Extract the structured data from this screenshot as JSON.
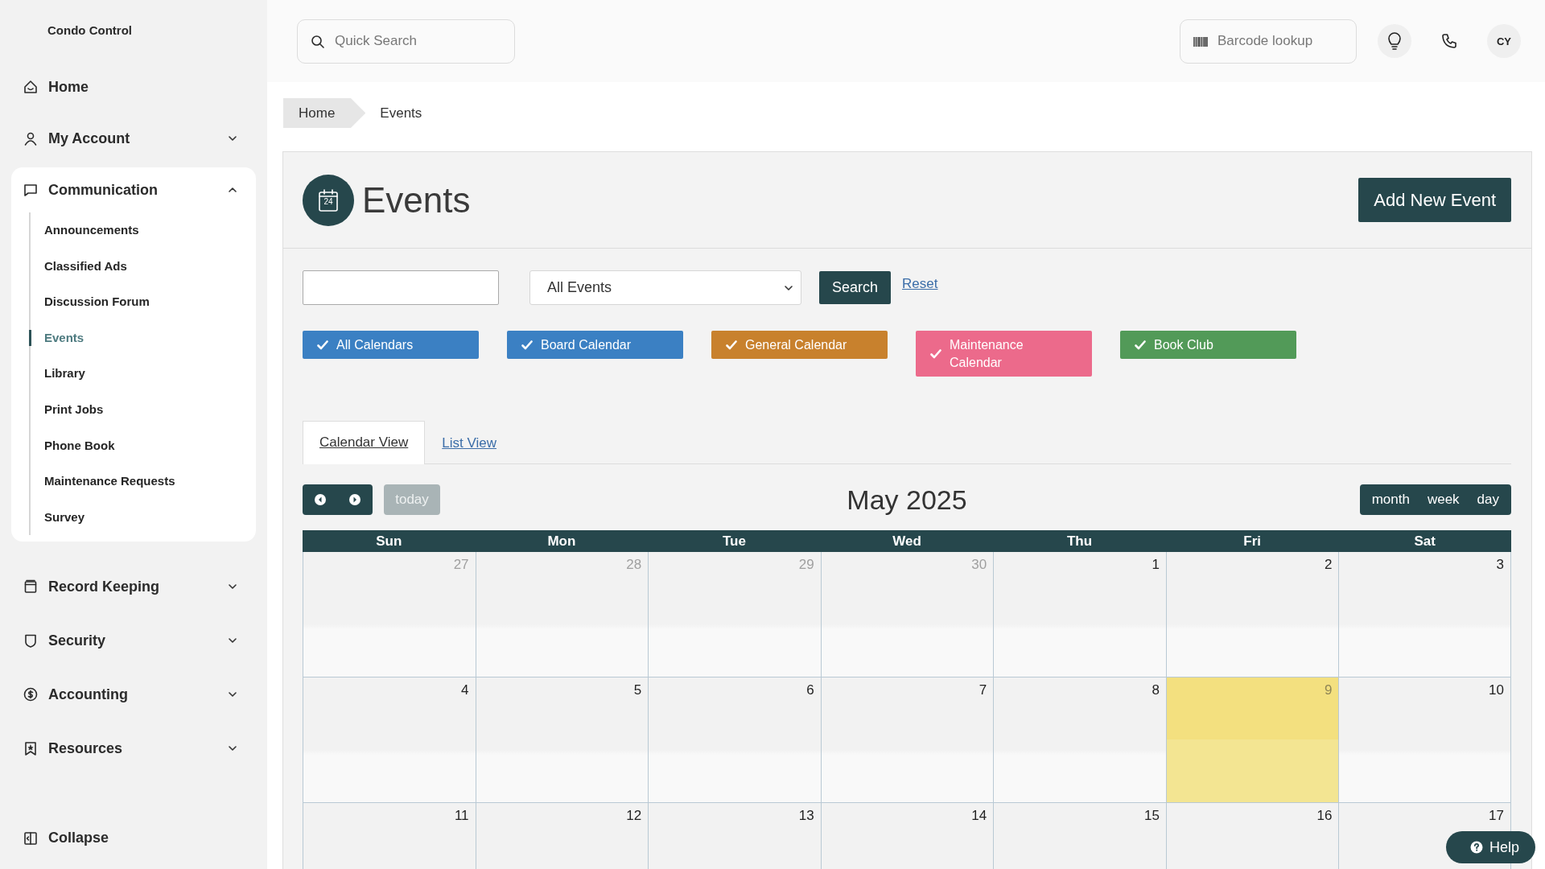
{
  "sidebar": {
    "brand": "Condo Control",
    "items": [
      {
        "kind": "link",
        "label": "Home"
      },
      {
        "kind": "group",
        "label": "My Account",
        "expanded": false
      },
      {
        "kind": "group",
        "label": "Communication",
        "expanded": true,
        "children": [
          {
            "label": "Announcements",
            "selected": false
          },
          {
            "label": "Classified Ads",
            "selected": false
          },
          {
            "label": "Discussion Forum",
            "selected": false
          },
          {
            "label": "Events",
            "selected": true
          },
          {
            "label": "Library",
            "selected": false
          },
          {
            "label": "Print Jobs",
            "selected": false
          },
          {
            "label": "Phone Book",
            "selected": false
          },
          {
            "label": "Maintenance Requests",
            "selected": false
          },
          {
            "label": "Survey",
            "selected": false
          }
        ]
      },
      {
        "kind": "group",
        "label": "Record Keeping",
        "expanded": false
      },
      {
        "kind": "group",
        "label": "Security",
        "expanded": false
      },
      {
        "kind": "group",
        "label": "Accounting",
        "expanded": false
      },
      {
        "kind": "group",
        "label": "Resources",
        "expanded": false
      }
    ],
    "collapse": "Collapse"
  },
  "topbar": {
    "search": {
      "placeholder": "Quick Search"
    },
    "barcode": {
      "placeholder": "Barcode lookup"
    },
    "avatar": "CY"
  },
  "breadcrumb": [
    "Home",
    "Events"
  ],
  "page": {
    "title": "Events",
    "icon_day": "24",
    "add_button": "Add New Event"
  },
  "filters": {
    "select": "All Events",
    "search_button": "Search",
    "reset": "Reset"
  },
  "calendars": [
    {
      "label": "All Calendars",
      "checked": true,
      "color": "#3b80c3"
    },
    {
      "label": "Board Calendar",
      "checked": true,
      "color": "#3b80c3"
    },
    {
      "label": "General Calendar",
      "checked": true,
      "color": "#c8812d"
    },
    {
      "label": "Maintenance Calendar",
      "checked": true,
      "color": "#ec6a8b"
    },
    {
      "label": "Book Club",
      "checked": true,
      "color": "#529a58"
    }
  ],
  "tabs": [
    {
      "label": "Calendar View",
      "selected": true
    },
    {
      "label": "List View",
      "selected": false
    }
  ],
  "calendar": {
    "today_button": "today",
    "title": "May 2025",
    "views": [
      "month",
      "week",
      "day"
    ],
    "weekdays": [
      "Sun",
      "Mon",
      "Tue",
      "Wed",
      "Thu",
      "Fri",
      "Sat"
    ],
    "weeks": [
      [
        {
          "day": "27",
          "other_month": true,
          "today": false
        },
        {
          "day": "28",
          "other_month": true,
          "today": false
        },
        {
          "day": "29",
          "other_month": true,
          "today": false
        },
        {
          "day": "30",
          "other_month": true,
          "today": false
        },
        {
          "day": "1",
          "other_month": false,
          "today": false
        },
        {
          "day": "2",
          "other_month": false,
          "today": false
        },
        {
          "day": "3",
          "other_month": false,
          "today": false
        }
      ],
      [
        {
          "day": "4",
          "other_month": false,
          "today": false
        },
        {
          "day": "5",
          "other_month": false,
          "today": false
        },
        {
          "day": "6",
          "other_month": false,
          "today": false
        },
        {
          "day": "7",
          "other_month": false,
          "today": false
        },
        {
          "day": "8",
          "other_month": false,
          "today": false
        },
        {
          "day": "9",
          "other_month": false,
          "today": true
        },
        {
          "day": "10",
          "other_month": false,
          "today": false
        }
      ],
      [
        {
          "day": "11",
          "other_month": false,
          "today": false
        },
        {
          "day": "12",
          "other_month": false,
          "today": false
        },
        {
          "day": "13",
          "other_month": false,
          "today": false
        },
        {
          "day": "14",
          "other_month": false,
          "today": false
        },
        {
          "day": "15",
          "other_month": false,
          "today": false
        },
        {
          "day": "16",
          "other_month": false,
          "today": false
        },
        {
          "day": "17",
          "other_month": false,
          "today": false
        }
      ]
    ]
  },
  "help_button": "Help"
}
